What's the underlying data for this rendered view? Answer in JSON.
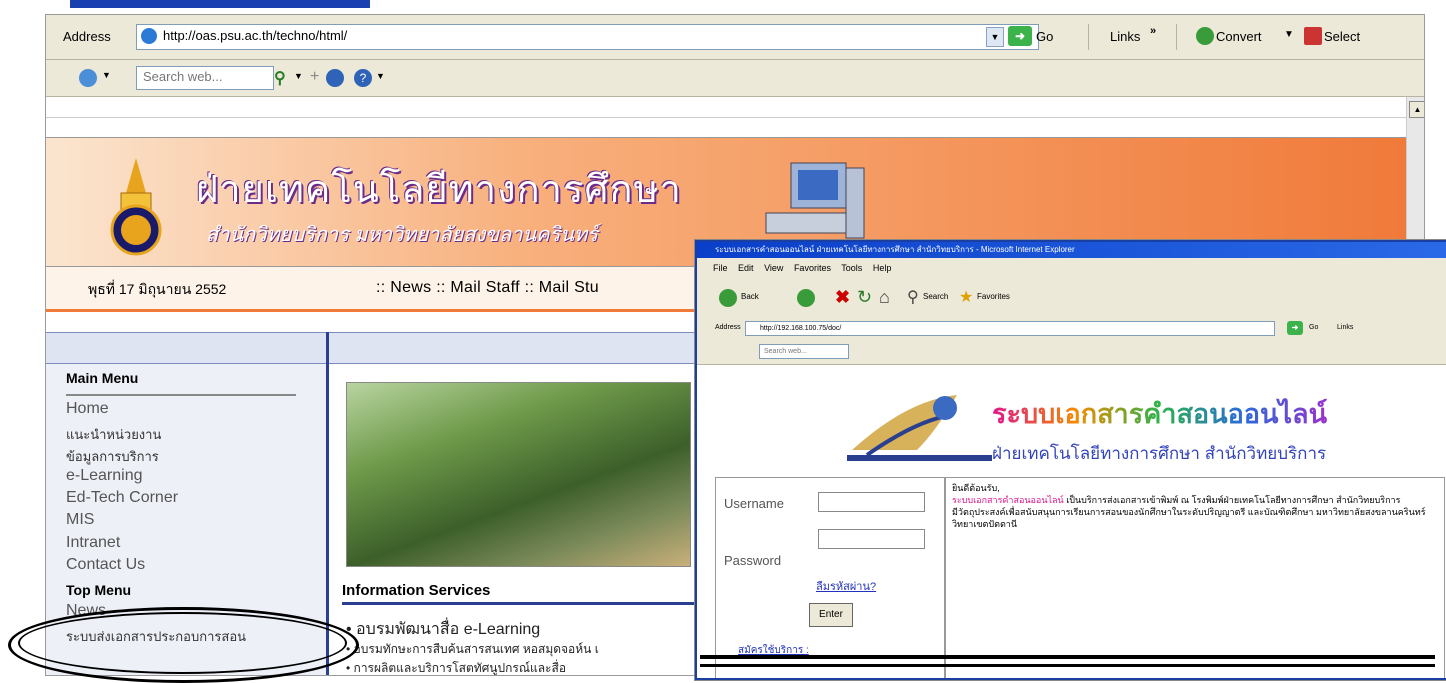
{
  "browser": {
    "address_label": "Address",
    "url": "http://oas.psu.ac.th/techno/html/",
    "go_label": "Go",
    "links_label": "Links",
    "links_more": "»",
    "convert_label": "Convert",
    "select_label": "Select",
    "search_placeholder": "Search web..."
  },
  "page": {
    "banner_title": "ฝ่ายเทคโนโลยีทางการศึกษา",
    "banner_subtitle": "สำนักวิทยบริการ มหาวิทยาลัยสงขลานครินทร์",
    "date": "พุธที่ 17 มิถุนายน 2552",
    "nav_links": ":: News :: Mail Staff :: Mail Stu",
    "main_menu_title": "Main Menu",
    "main_menu": [
      {
        "label": "Home",
        "size": "big"
      },
      {
        "label": "แนะนำหน่วยงาน",
        "size": "small"
      },
      {
        "label": "ข้อมูลการบริการ",
        "size": "small"
      },
      {
        "label": "e-Learning",
        "size": "big"
      },
      {
        "label": "Ed-Tech Corner",
        "size": "big"
      },
      {
        "label": "MIS",
        "size": "big"
      },
      {
        "label": "Intranet",
        "size": "big"
      },
      {
        "label": "Contact Us",
        "size": "big"
      }
    ],
    "top_menu_title": "Top Menu",
    "top_menu": [
      {
        "label": "News",
        "size": "big"
      },
      {
        "label": "ระบบส่งเอกสารประกอบการสอน",
        "size": "small"
      }
    ],
    "info_services_title": "Information Services",
    "info_items": [
      "อบรมพัฒนาสื่อ e-Learning",
      "อบรมทักษะการสืบค้นสารสนเทศ หอสมุดจอห์น เ",
      "การผลิตและบริการโสตทัศนูปกรณ์และสื่อ"
    ]
  },
  "popup": {
    "window_title": "ระบบเอกสารคำสอนออนไลน์ ฝ่ายเทคโนโลยีทางการศึกษา สำนักวิทยบริการ - Microsoft Internet Explorer",
    "menu": [
      "File",
      "Edit",
      "View",
      "Favorites",
      "Tools",
      "Help"
    ],
    "back_label": "Back",
    "search_label": "Search",
    "favorites_label": "Favorites",
    "address_label": "Address",
    "url": "http://192.168.100.75/doc/",
    "go_label": "Go",
    "links_label": "Links",
    "search_placeholder": "Search web...",
    "site_title": "ระบบเอกสารคำสอนออนไลน์",
    "site_subtitle": "ฝ่ายเทคโนโลยีทางการศึกษา สำนักวิทยบริการ",
    "username_label": "Username",
    "password_label": "Password",
    "forgot_label": "ลืมรหัสผ่าน?",
    "enter_label": "Enter",
    "register_label": "สมัครใช้บริการ :",
    "welcome_title": "ยินดีต้อนรับ,",
    "welcome_highlight": "ระบบเอกสารคำสอนออนไลน์",
    "welcome_text": " เป็นบริการส่งเอกสารเข้าพิมพ์ ณ โรงพิมพ์ฝ่ายเทคโนโลยีทางการศึกษา สำนักวิทยบริการ",
    "welcome_text2": "มีวัตถุประสงค์เพื่อสนับสนุนการเรียนการสอนของนักศึกษาในระดับปริญญาตรี และบัณฑิตศึกษา มหาวิทยาลัยสงขลานครินทร์ วิทยาเขตปัตตานี"
  }
}
